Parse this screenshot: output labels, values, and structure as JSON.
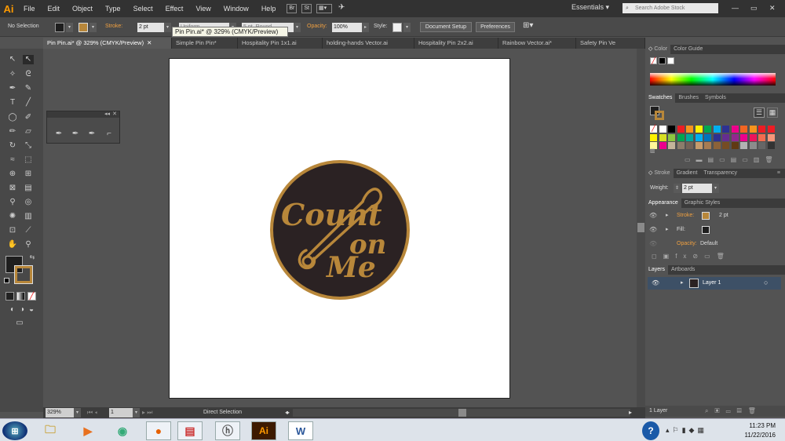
{
  "app": {
    "logo": "Ai"
  },
  "menu": [
    "File",
    "Edit",
    "Object",
    "Type",
    "Select",
    "Effect",
    "View",
    "Window",
    "Help"
  ],
  "menu_extras": {
    "bridge": "Br",
    "stock": "St"
  },
  "workspace": "Essentials",
  "search_placeholder": "Search Adobe Stock",
  "control": {
    "selection": "No Selection",
    "stroke_label": "Stroke:",
    "stroke_value": "2 pt",
    "uniform": "Uniform",
    "brush": "5 pt. Round",
    "opacity_label": "Opacity:",
    "opacity_value": "100%",
    "style_label": "Style:",
    "doc_setup": "Document Setup",
    "preferences": "Preferences"
  },
  "tooltip": "Pin Pin.ai* @ 329% (CMYK/Preview)",
  "tabs": [
    {
      "label": "Pin Pin.ai* @ 329% (CMYK/Preview)",
      "active": true
    },
    {
      "label": "Simple Pin Pin*"
    },
    {
      "label": "Hospitality Pin 1x1.ai"
    },
    {
      "label": "holding-hands Vector.ai"
    },
    {
      "label": "Hospitality Pin 2x2.ai"
    },
    {
      "label": "Rainbow Vector.ai*"
    },
    {
      "label": "Safety Pin Ve"
    }
  ],
  "artwork": {
    "line1": "Count",
    "line2": "on",
    "line3": "Me",
    "circle_color": "#2b2223",
    "ink_color": "#b8873a"
  },
  "status": {
    "zoom": "329%",
    "artboard": "1",
    "tool": "Direct Selection"
  },
  "panels": {
    "color_tabs": [
      "Color",
      "Color Guide"
    ],
    "swatch_tabs": [
      "Swatches",
      "Brushes",
      "Symbols"
    ],
    "stroke_tabs": [
      "Stroke",
      "Gradient",
      "Transparency"
    ],
    "weight_label": "Weight:",
    "weight_value": "2 pt",
    "appearance_tabs": [
      "Appearance",
      "Graphic Styles"
    ],
    "appearance_rows": {
      "stroke_label": "Stroke:",
      "stroke_value": "2 pt",
      "fill_label": "Fill:",
      "opacity_label": "Opacity:",
      "opacity_value": "Default"
    },
    "layers_tabs": [
      "Layers",
      "Artboards"
    ],
    "layer_name": "Layer 1",
    "layers_count": "1 Layer"
  },
  "swatch_colors": [
    "#ffffff",
    "#ffffff",
    "#000000",
    "#ed1c24",
    "#f7941d",
    "#fff200",
    "#00a651",
    "#00aeef",
    "#2e3192",
    "#ec008c",
    "#f26522",
    "#f7941d",
    "#ed1c24",
    "#ed1c24",
    "#fff200",
    "#d7df23",
    "#8dc63f",
    "#00a651",
    "#00a99d",
    "#00aeef",
    "#0072bc",
    "#2e3192",
    "#662d91",
    "#92278f",
    "#ec008c",
    "#ed145b",
    "#f26c4f",
    "#f69679",
    "#fff799",
    "#ec008c",
    "#c4b59a",
    "#8b7d6b",
    "#736357",
    "#c69c6d",
    "#a67c52",
    "#8c6239",
    "#754c24",
    "#603913",
    "#b3b3b3",
    "#8c8c8c",
    "#666666",
    "#333333"
  ],
  "taskbar": {
    "time": "11:23 PM",
    "date": "11/22/2016"
  }
}
